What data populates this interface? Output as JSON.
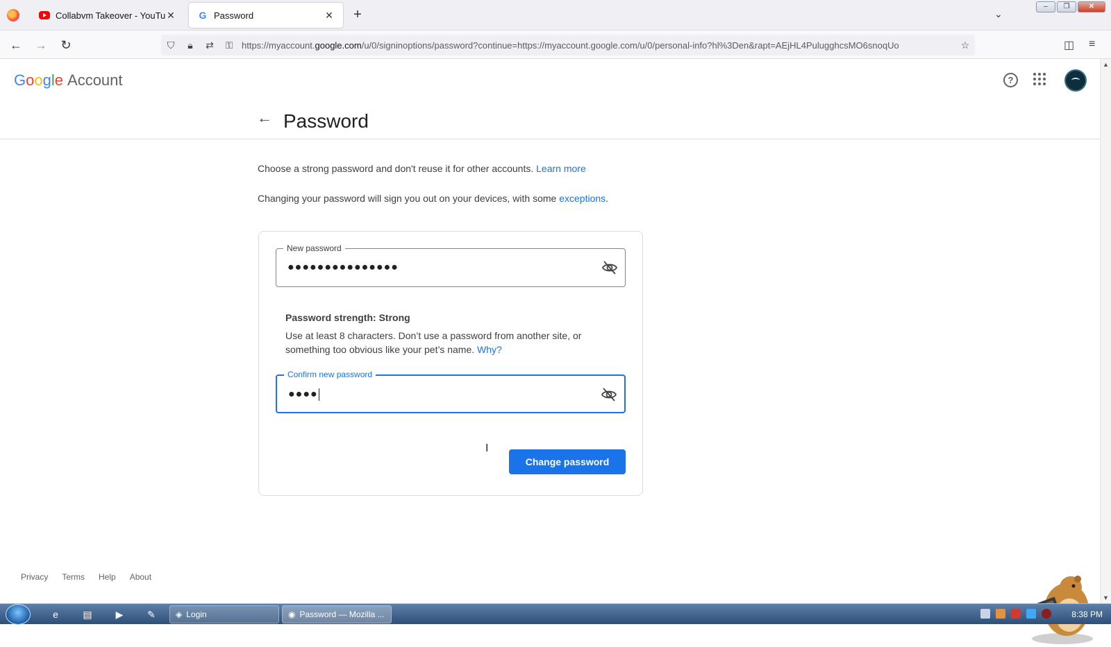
{
  "browser": {
    "tabs": [
      {
        "label": "Collabvm Takeover - YouTube",
        "close": "✕"
      },
      {
        "label": "Password",
        "close": "✕"
      }
    ],
    "new_tab": "+",
    "url_prefix": "https://myaccount.",
    "url_host": "google.com",
    "url_rest": "/u/0/signinoptions/password?continue=https://myaccount.google.com/u/0/personal-info?hl%3Den&rapt=AEjHL4PulugghcsMO6snoqUo"
  },
  "header": {
    "logo": [
      "G",
      "o",
      "o",
      "g",
      "l",
      "e"
    ],
    "account_label": "Account"
  },
  "title": "Password",
  "description": {
    "line1_text": "Choose a strong password and don't reuse it for other accounts.",
    "line1_link": "Learn more",
    "line2_text": "Changing your password will sign you out on your devices, with some",
    "line2_link": "exceptions",
    "line2_end": "."
  },
  "form": {
    "new_password_label": "New password",
    "new_password_value": "●●●●●●●●●●●●●●●",
    "strength_label": "Password strength: Strong",
    "hint_text": "Use at least 8 characters. Don’t use a password from another site, or something too obvious like your pet’s name.",
    "hint_link": "Why?",
    "confirm_label": "Confirm new password",
    "confirm_value": "●●●●",
    "submit_label": "Change password"
  },
  "footer": {
    "links": [
      "Privacy",
      "Terms",
      "Help",
      "About"
    ]
  },
  "taskbar": {
    "tasks": [
      "Login",
      "Password — Mozilla ..."
    ],
    "time": "8:38 PM"
  },
  "colors": {
    "accent": "#1a73e8",
    "google_blue": "#4285f4",
    "google_red": "#ea4335",
    "google_yellow": "#fbbc05",
    "google_green": "#34a853"
  }
}
